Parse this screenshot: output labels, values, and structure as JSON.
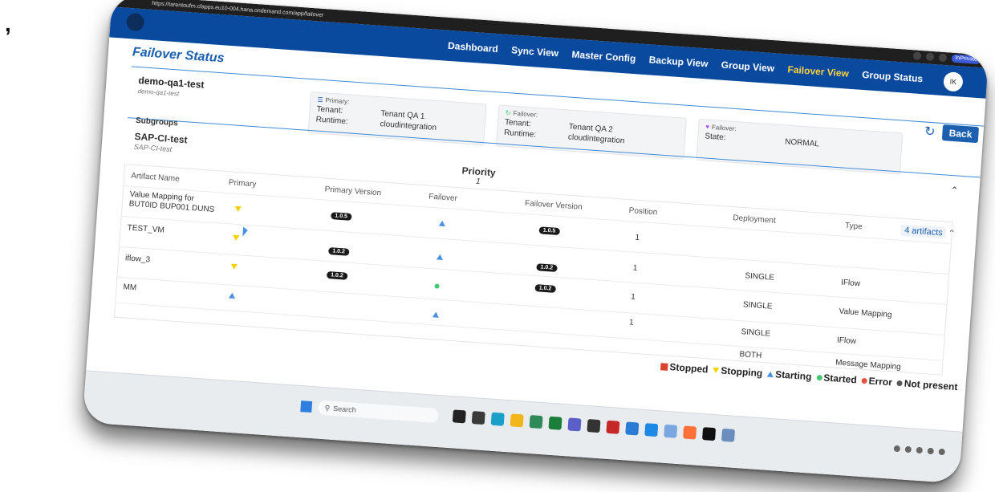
{
  "stray_mark": ",",
  "browser": {
    "url": "https://tarentoufm.cfapps.eu10-004.hana.ondemand.com/app/failover",
    "badge": "InPrivate"
  },
  "nav": {
    "items": [
      "Dashboard",
      "Sync View",
      "Master Config",
      "Backup View",
      "Group View",
      "Failover View",
      "Group Status"
    ],
    "active": "Failover View",
    "avatar": "IK"
  },
  "page": {
    "title": "Failover Status",
    "back_label": "Back",
    "refresh_icon": "refresh-icon"
  },
  "group": {
    "name": "demo-qa1-test",
    "sub": "demo-qa1-test",
    "primary": {
      "title": "Primary:",
      "tenant_label": "Tenant:",
      "tenant": "Tenant QA 1",
      "runtime_label": "Runtime:",
      "runtime": "cloudintegration"
    },
    "failover": {
      "title": "Failover:",
      "tenant_label": "Tenant:",
      "tenant": "Tenant QA 2",
      "runtime_label": "Runtime:",
      "runtime": "cloudintegration"
    },
    "state": {
      "title": "Failover:",
      "label": "State:",
      "value": "NORMAL"
    }
  },
  "subgroups": {
    "label": "Subgroups",
    "name": "SAP-CI-test",
    "sub": "SAP-CI-test",
    "priority_label": "Priority",
    "priority": "1",
    "artifact_count": "4 artifacts"
  },
  "table": {
    "headers": [
      "Artifact Name",
      "Primary",
      "Primary Version",
      "Failover",
      "Failover Version",
      "Position",
      "Deployment",
      "Type"
    ],
    "rows": [
      {
        "name": "Value Mapping for BUT0ID BUP001 DUNS",
        "primary_version": "1.0.5",
        "failover_version": "1.0.5",
        "position": "1",
        "deployment": "",
        "type": ""
      },
      {
        "name": "TEST_VM",
        "primary_version": "1.0.2",
        "failover_version": "1.0.2",
        "position": "1",
        "deployment": "SINGLE",
        "type": "IFlow"
      },
      {
        "name": "iflow_3",
        "primary_version": "1.0.2",
        "failover_version": "1.0.2",
        "position": "1",
        "deployment": "SINGLE",
        "type": "Value Mapping"
      },
      {
        "name": "MM",
        "primary_version": "",
        "failover_version": "",
        "position": "1",
        "deployment": "SINGLE",
        "type": "IFlow"
      },
      {
        "name": "",
        "primary_version": "",
        "failover_version": "",
        "position": "",
        "deployment": "BOTH",
        "type": "Message Mapping"
      }
    ]
  },
  "legend": [
    "Stopped",
    "Stopping",
    "Starting",
    "Started",
    "Error",
    "Not present"
  ],
  "taskbar": {
    "search_label": "Search"
  }
}
